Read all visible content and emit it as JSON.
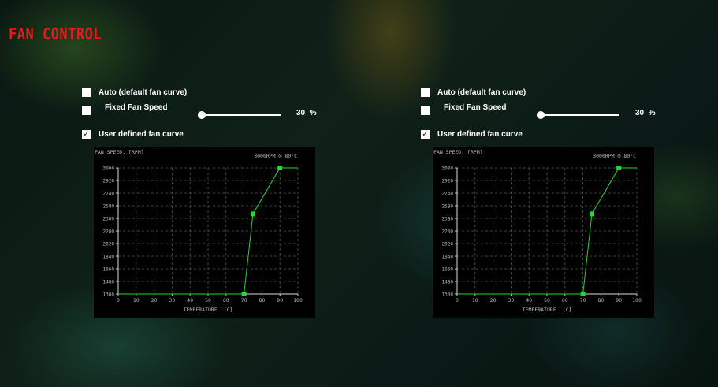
{
  "title": "FAN CONTROL",
  "colors": {
    "title": "#e8191e",
    "curve": "#2bd43c",
    "grid": "#555555",
    "chart_bg": "#000000"
  },
  "panels": [
    {
      "options": {
        "auto_label": "Auto (default fan curve)",
        "fixed_label": "Fixed Fan Speed",
        "user_label": "User defined fan curve",
        "selected": "user"
      },
      "fixed_speed": {
        "value": "30",
        "unit": "%",
        "fraction": 0.0
      },
      "chart_data": {
        "type": "line",
        "ylabel": "FAN SPEED. [RPM]",
        "xlabel": "TEMPERATURE. [C]",
        "annotation": "3000RPM @ 80°C",
        "x_ticks": [
          "0",
          "10",
          "20",
          "30",
          "40",
          "50",
          "60",
          "70",
          "80",
          "90",
          "100"
        ],
        "y_ticks": [
          "3000",
          "2920",
          "2740",
          "2580",
          "2380",
          "2200",
          "2020",
          "1840",
          "1660",
          "1480",
          "1300"
        ],
        "xlim": [
          0,
          100
        ],
        "ylim": [
          1300,
          3000
        ],
        "grid": true,
        "series": [
          {
            "x": [
              0,
              70,
              75,
              90,
              100
            ],
            "y": [
              1300,
              1300,
              2380,
              3000,
              3000
            ]
          }
        ],
        "control_points": [
          {
            "x": 70,
            "y": 1300
          },
          {
            "x": 75,
            "y": 2380
          },
          {
            "x": 90,
            "y": 3000
          }
        ]
      }
    },
    {
      "options": {
        "auto_label": "Auto (default fan curve)",
        "fixed_label": "Fixed Fan Speed",
        "user_label": "User defined fan curve",
        "selected": "user"
      },
      "fixed_speed": {
        "value": "30",
        "unit": "%",
        "fraction": 0.0
      },
      "chart_data": {
        "type": "line",
        "ylabel": "FAN SPEED. [RPM]",
        "xlabel": "TEMPERATURE. [C]",
        "annotation": "3000RPM @ 80°C",
        "x_ticks": [
          "0",
          "10",
          "20",
          "30",
          "40",
          "50",
          "60",
          "70",
          "80",
          "90",
          "100"
        ],
        "y_ticks": [
          "3000",
          "2920",
          "2740",
          "2580",
          "2380",
          "2200",
          "2020",
          "1840",
          "1660",
          "1480",
          "1300"
        ],
        "xlim": [
          0,
          100
        ],
        "ylim": [
          1300,
          3000
        ],
        "grid": true,
        "series": [
          {
            "x": [
              0,
              70,
              75,
              90,
              100
            ],
            "y": [
              1300,
              1300,
              2380,
              3000,
              3000
            ]
          }
        ],
        "control_points": [
          {
            "x": 70,
            "y": 1300
          },
          {
            "x": 75,
            "y": 2380
          },
          {
            "x": 90,
            "y": 3000
          }
        ]
      }
    }
  ]
}
